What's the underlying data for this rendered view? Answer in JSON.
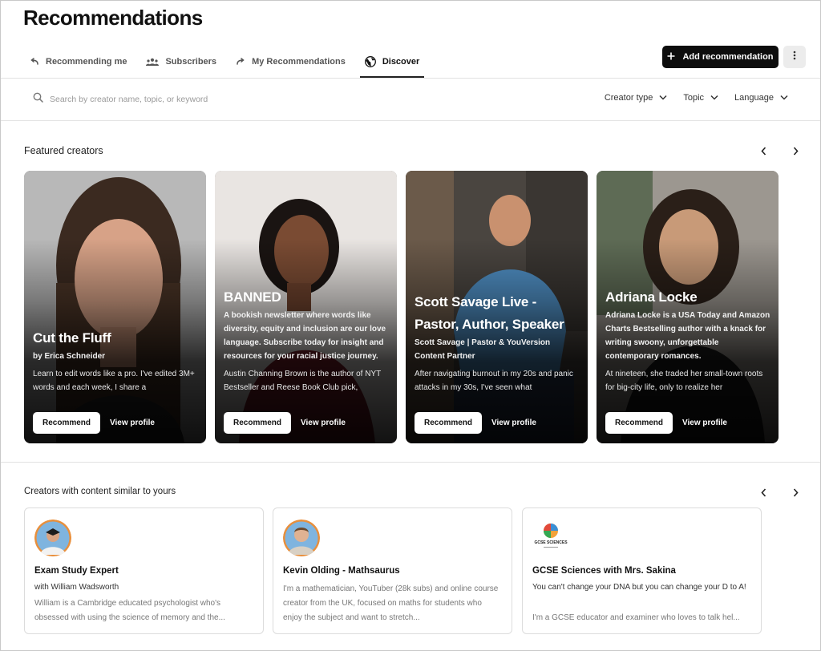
{
  "page": {
    "title": "Recommendations"
  },
  "tabs": [
    {
      "label": "Recommending me",
      "icon": "arrow-return-icon"
    },
    {
      "label": "Subscribers",
      "icon": "people-icon"
    },
    {
      "label": "My Recommendations",
      "icon": "arrow-forward-icon"
    },
    {
      "label": "Discover",
      "icon": "globe-icon",
      "active": true
    }
  ],
  "header": {
    "add_label": "Add recommendation",
    "more_icon": "more-vertical-icon"
  },
  "search": {
    "placeholder": "Search by creator name, topic, or keyword"
  },
  "filters": [
    {
      "label": "Creator type"
    },
    {
      "label": "Topic"
    },
    {
      "label": "Language"
    }
  ],
  "featured": {
    "title": "Featured creators",
    "recommend_label": "Recommend",
    "view_label": "View profile",
    "cards": [
      {
        "name": "Cut the Fluff",
        "subtitle": "by Erica Schneider",
        "description": "Learn to edit words like a pro. I've edited 3M+ words and each week, I share a"
      },
      {
        "name": "BANNED",
        "subtitle": "A bookish newsletter where words like diversity, equity and inclusion are our love language. Subscribe today for insight and resources for your racial justice journey.",
        "description": "Austin Channing Brown is the author of NYT Bestseller and Reese Book Club pick,"
      },
      {
        "name": "Scott Savage Live - Pastor, Author, Speaker",
        "subtitle": "Scott Savage | Pastor & YouVersion Content Partner",
        "description": "After navigating burnout in my 20s and panic attacks in my 30s, I've seen what"
      },
      {
        "name": "Adriana Locke",
        "subtitle": "Adriana Locke is a USA Today and Amazon Charts Bestselling author with a knack for writing swoony, unforgettable contemporary romances.",
        "description": "At nineteen, she traded her small-town roots for big-city life, only to realize her"
      }
    ]
  },
  "similar": {
    "title": "Creators with content similar to yours",
    "cards": [
      {
        "name": "Exam Study Expert",
        "subtitle": "with William Wadsworth",
        "description": "William is a Cambridge educated psychologist who's obsessed with using the science of memory and the..."
      },
      {
        "name": "Kevin Olding - Mathsaurus",
        "subtitle": "",
        "description": "I'm a mathematician, YouTuber (28k subs) and online course creator from the UK, focused on maths for students who enjoy the subject and want to stretch..."
      },
      {
        "name": "GCSE Sciences with Mrs. Sakina",
        "subtitle": "You can't change your DNA but you can change your D to A!",
        "description": "I'm a GCSE educator and examiner who loves to talk hel...",
        "logo_text": "GCSE SCIENCES"
      }
    ]
  },
  "colors": {
    "primary": "#0d0d0d",
    "border": "#e2e2e2",
    "muted_text": "#777777"
  }
}
